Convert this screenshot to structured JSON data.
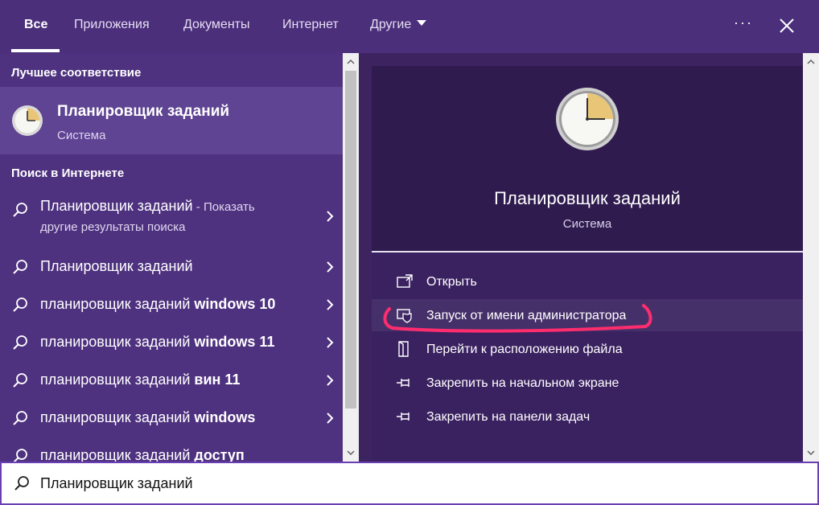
{
  "tabs": [
    {
      "label": "Все",
      "active": true
    },
    {
      "label": "Приложения"
    },
    {
      "label": "Документы"
    },
    {
      "label": "Интернет"
    },
    {
      "label": "Другие"
    }
  ],
  "header": {
    "more_icon": "ellipsis-icon",
    "close_icon": "close-icon"
  },
  "best_match": {
    "section_title": "Лучшее соответствие",
    "name": "Планировщик заданий",
    "subtitle": "Система",
    "icon": "clock-icon"
  },
  "web": {
    "section_title": "Поиск в Интернете",
    "first": {
      "term": "Планировщик заданий",
      "hint": " - Показать",
      "hint2": "другие результаты поиска"
    },
    "items": [
      {
        "prefix": "Планировщик заданий",
        "bold": ""
      },
      {
        "prefix": "планировщик заданий ",
        "bold": "windows 10"
      },
      {
        "prefix": "планировщик заданий ",
        "bold": "windows 11"
      },
      {
        "prefix": "планировщик заданий ",
        "bold": "вин 11"
      },
      {
        "prefix": "планировщик заданий ",
        "bold": "windows"
      },
      {
        "prefix": "планировщик заданий ",
        "bold": "доступ"
      }
    ]
  },
  "preview": {
    "name": "Планировщик заданий",
    "subtitle": "Система",
    "actions": [
      {
        "label": "Открыть",
        "icon": "open-icon"
      },
      {
        "label": "Запуск от имени администратора",
        "icon": "shield-icon"
      },
      {
        "label": "Перейти к расположению файла",
        "icon": "file-location-icon"
      },
      {
        "label": "Закрепить на начальном экране",
        "icon": "pin-icon"
      },
      {
        "label": "Закрепить на панели задач",
        "icon": "pin-icon"
      }
    ]
  },
  "search": {
    "value": "Планировщик заданий"
  },
  "colors": {
    "accent": "#4b2f7b",
    "highlight": "#5f4493",
    "annotation": "#ff2d6e"
  }
}
